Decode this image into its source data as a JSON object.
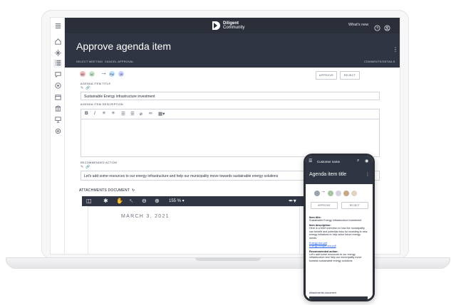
{
  "header": {
    "brand_line1": "Diligent",
    "brand_line2": "Community",
    "whats_new": "What's new"
  },
  "page": {
    "title": "Approve agenda item",
    "links": {
      "select_meeting": "SELECT MEETING",
      "cancel_approval": "CANCEL APPROVAL",
      "comments_details": "COMMENTS/DETAILS"
    }
  },
  "approvers": [
    {
      "initials": "BS",
      "color": "#f3b8b8"
    },
    {
      "initials": "AC",
      "color": "#c8e6c9"
    },
    {
      "initials": "PW",
      "color": "#bbdefb"
    },
    {
      "initials": "JR",
      "color": "#c7d2fe"
    }
  ],
  "actions": {
    "approve": "APPROVE",
    "reject": "REJECT"
  },
  "agenda_item": {
    "title_label": "AGENDA ITEM TITLE",
    "title_value": "Sustainable Energy infrastructure investment",
    "description_label": "AGENDA ITEM DESCRIPTION",
    "recommended_label": "RECOMMENDED ACTION",
    "recommended_value": "Let's add some resources to our energy infrastructure and help our municipality move towards sustainable energy solutions"
  },
  "attachments": {
    "title": "ATTACHMENTS DOCUMENT",
    "zoom": "155 %",
    "doc_date": "MARCH 3, 2021"
  },
  "mobile": {
    "header_title": "Customer name",
    "page_title": "Agenda item title",
    "approve": "APPROVE",
    "reject": "REJECT",
    "item_title_heading": "Item title:",
    "item_title_value": "Sustainable Energy infrastructure investment",
    "item_desc_heading": "Item description:",
    "item_desc_value": "Here is a brief overview on how the municipality can benefit and potential risks for investing in new energy initiatives to help solve future energy needs.",
    "links": [
      "Energy-doc.pdf",
      "Energy-budget-doc.pdf"
    ],
    "recommended_heading": "Recommended action:",
    "recommended_value": "Let's add some resources to our energy infrastructure and help our municipality move towards sustainable energy solutions",
    "attachments_heading": "Attachments document"
  },
  "colors": {
    "header_bg": "#2a2f3a",
    "band_bg": "#2f3542",
    "link_blue": "#2563eb"
  },
  "icons": {
    "rail": [
      "menu-icon",
      "home-icon",
      "dashboard-icon",
      "list-icon",
      "chat-icon",
      "target-icon",
      "calendar-icon",
      "library-icon",
      "presentation-icon",
      "settings-icon"
    ],
    "viewer": [
      "sidebar-icon",
      "settings-icon",
      "hand-icon",
      "pointer-icon",
      "zoom-out-icon",
      "zoom-in-icon",
      "pen-icon"
    ]
  }
}
